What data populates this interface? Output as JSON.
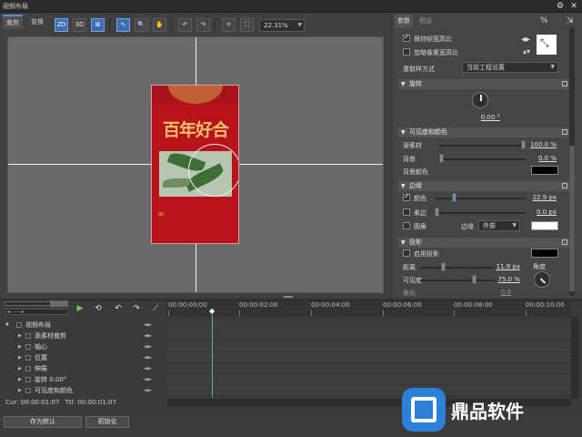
{
  "window": {
    "title": "视频布局"
  },
  "left_tabs": [
    "裁剪",
    "变换"
  ],
  "zoom": "22.31%",
  "right_tabs": [
    "参数",
    "预设"
  ],
  "top_right_icons": [
    "%",
    "pin"
  ],
  "params": {
    "keep_ratio": "保持帧宽高比",
    "ignore_pixel_ratio": "忽略像素宽高比",
    "resample_label": "重取样方式",
    "resample_value": "当前工程设置",
    "rotation_section": "旋转",
    "rotation_value": "0.00 °",
    "visibility_section": "可见度和颜色",
    "source_label": "源素材",
    "source_value": "100.0 %",
    "background_label": "背景",
    "background_value": "0.0 %",
    "bgcolor_label": "背景颜色",
    "border_section": "边缘",
    "color_label": "颜色",
    "color_value": "22.9 px",
    "soft_label": "柔边",
    "soft_value": "0.0 px",
    "round_label": "圆角",
    "edge_label": "边缘",
    "edge_value": "外部",
    "shadow_section": "投影",
    "enable_shadow": "启用投影",
    "distance_label": "距离",
    "distance_value": "11.9 px",
    "angle_label": "角度",
    "visibility_label": "可见度",
    "visibility_value": "75.0 %",
    "blur_label": "柔化",
    "blur_value": "0.0"
  },
  "card": {
    "title": "百年好合"
  },
  "timeline": {
    "ticks": [
      "00:00:00:00",
      "00:00:02:00",
      "00:00:04:00",
      "00:00:06:00",
      "00:00:08:00",
      "00:00:10:00"
    ],
    "tracks": [
      {
        "label": "视频布局"
      },
      {
        "label": "源素材裁剪"
      },
      {
        "label": "轴心"
      },
      {
        "label": "位置"
      },
      {
        "label": "伸展"
      },
      {
        "label": "旋转 0.00°"
      },
      {
        "label": "可见度和颜色"
      }
    ],
    "cur_label": "Cur:",
    "cur_value": "00:00:01:07",
    "ttl_label": "Ttl:",
    "ttl_value": "00:00:01:07",
    "playhead_position": 0.11
  },
  "bottom": {
    "save_default": "存为默认",
    "reset": "初始化"
  },
  "brand": {
    "name": "鼎品软件"
  },
  "colors": {
    "accent": "#3fb4b8",
    "card_red": "#b8131a",
    "selected_tool": "#3b6fb2"
  }
}
